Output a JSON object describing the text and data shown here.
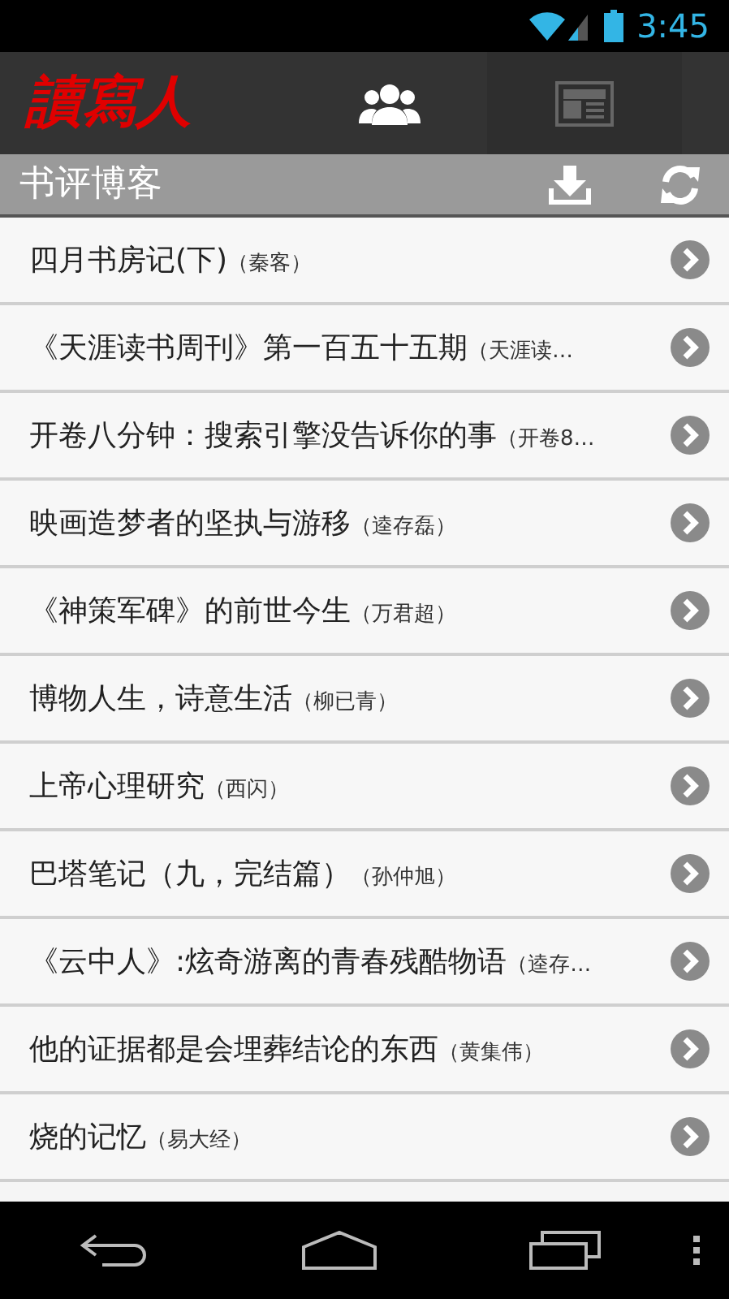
{
  "status_bar": {
    "time": "3:45"
  },
  "app_bar": {
    "logo": "讀寫人",
    "tabs": [
      {
        "kind": "people",
        "selected": true
      },
      {
        "kind": "news",
        "selected": false
      }
    ]
  },
  "section_bar": {
    "title": "书评博客"
  },
  "rows": [
    {
      "title": "四月书房记(下)",
      "author": "（秦客）"
    },
    {
      "title": "《天涯读书周刊》第一百五十五期",
      "author": "（天涯读…"
    },
    {
      "title": "开卷八分钟：搜索引擎没告诉你的事",
      "author": "（开卷8…"
    },
    {
      "title": "映画造梦者的坚执与游移",
      "author": "（逵存磊）"
    },
    {
      "title": "《神策军碑》的前世今生",
      "author": "（万君超）"
    },
    {
      "title": "博物人生，诗意生活",
      "author": "（柳已青）"
    },
    {
      "title": "上帝心理研究",
      "author": "（西闪）"
    },
    {
      "title": "巴塔笔记（九，完结篇）",
      "author": "（孙仲旭）"
    },
    {
      "title": "《云中人》:炫奇游离的青春残酷物语",
      "author": "（逵存…"
    },
    {
      "title": "他的证据都是会埋葬结论的东西",
      "author": "（黄集伟）"
    },
    {
      "title": "烧的记忆",
      "author": "（易大经）"
    }
  ]
}
